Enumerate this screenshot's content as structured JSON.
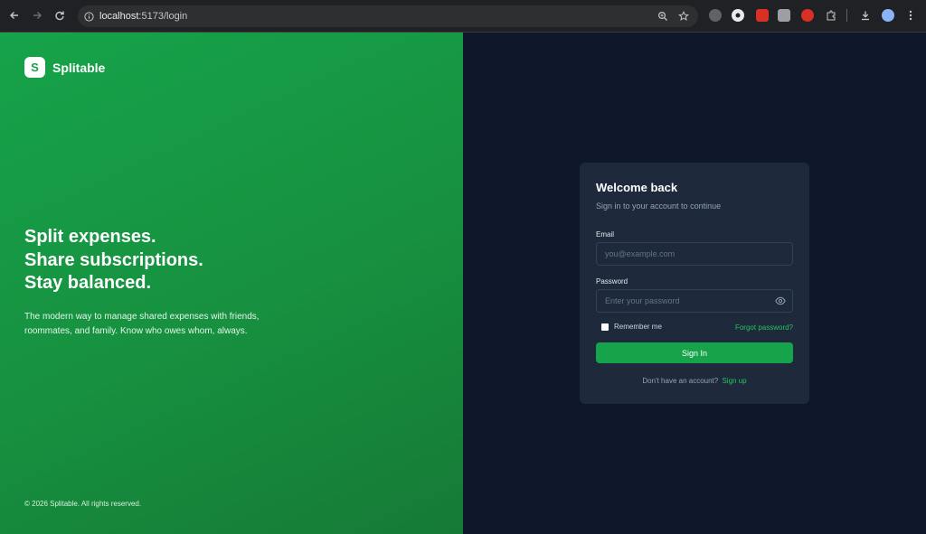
{
  "browser": {
    "url_host": "localhost",
    "url_path": ":5173/login"
  },
  "brand": {
    "logo_letter": "S",
    "name": "Splitable"
  },
  "hero": {
    "line1": "Split expenses.",
    "line2": "Share subscriptions.",
    "line3": "Stay balanced.",
    "description": "The modern way to manage shared expenses with friends, roommates, and family. Know who owes whom, always."
  },
  "footer": {
    "copyright": "© 2026 Splitable. All rights reserved."
  },
  "login": {
    "title": "Welcome back",
    "subtitle": "Sign in to your account to continue",
    "email_label": "Email",
    "email_placeholder": "you@example.com",
    "password_label": "Password",
    "password_placeholder": "Enter your password",
    "remember_label": "Remember me",
    "forgot_link": "Forgot password?",
    "submit_label": "Sign In",
    "no_account_text": "Don't have an account?",
    "signup_link": "Sign up"
  },
  "colors": {
    "brand_green": "#16a34a",
    "link_green": "#22c55e",
    "panel_dark": "#0f172a",
    "card_bg": "#1e293b"
  }
}
